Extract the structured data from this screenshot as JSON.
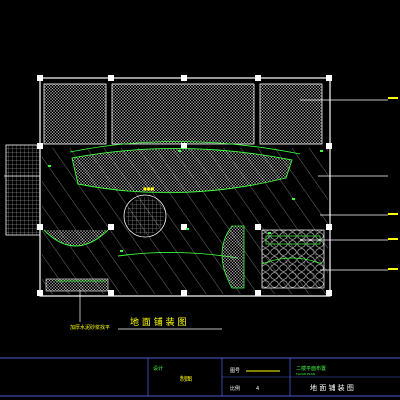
{
  "colors": {
    "background": "#000000",
    "wall": "#ffffff",
    "hatch": "#c8c8c8",
    "accent_green": "#3cff3c",
    "title_yellow": "#ffff00",
    "border_blue": "#4a5bd6",
    "leader": "#ffffff"
  },
  "drawing": {
    "caption": "地 面 铺 装 图",
    "left_note": "加厚水泥砂浆找平"
  },
  "title_block": {
    "design_label": "设计",
    "draw_label": "制图",
    "sheet_label": "图号",
    "sheet_value": "4",
    "project_name": "二楼平面布置",
    "project_sub": "FLOOR PLAN",
    "drawing_name": "地 面 铺 装 图",
    "scale_label": "比例"
  }
}
